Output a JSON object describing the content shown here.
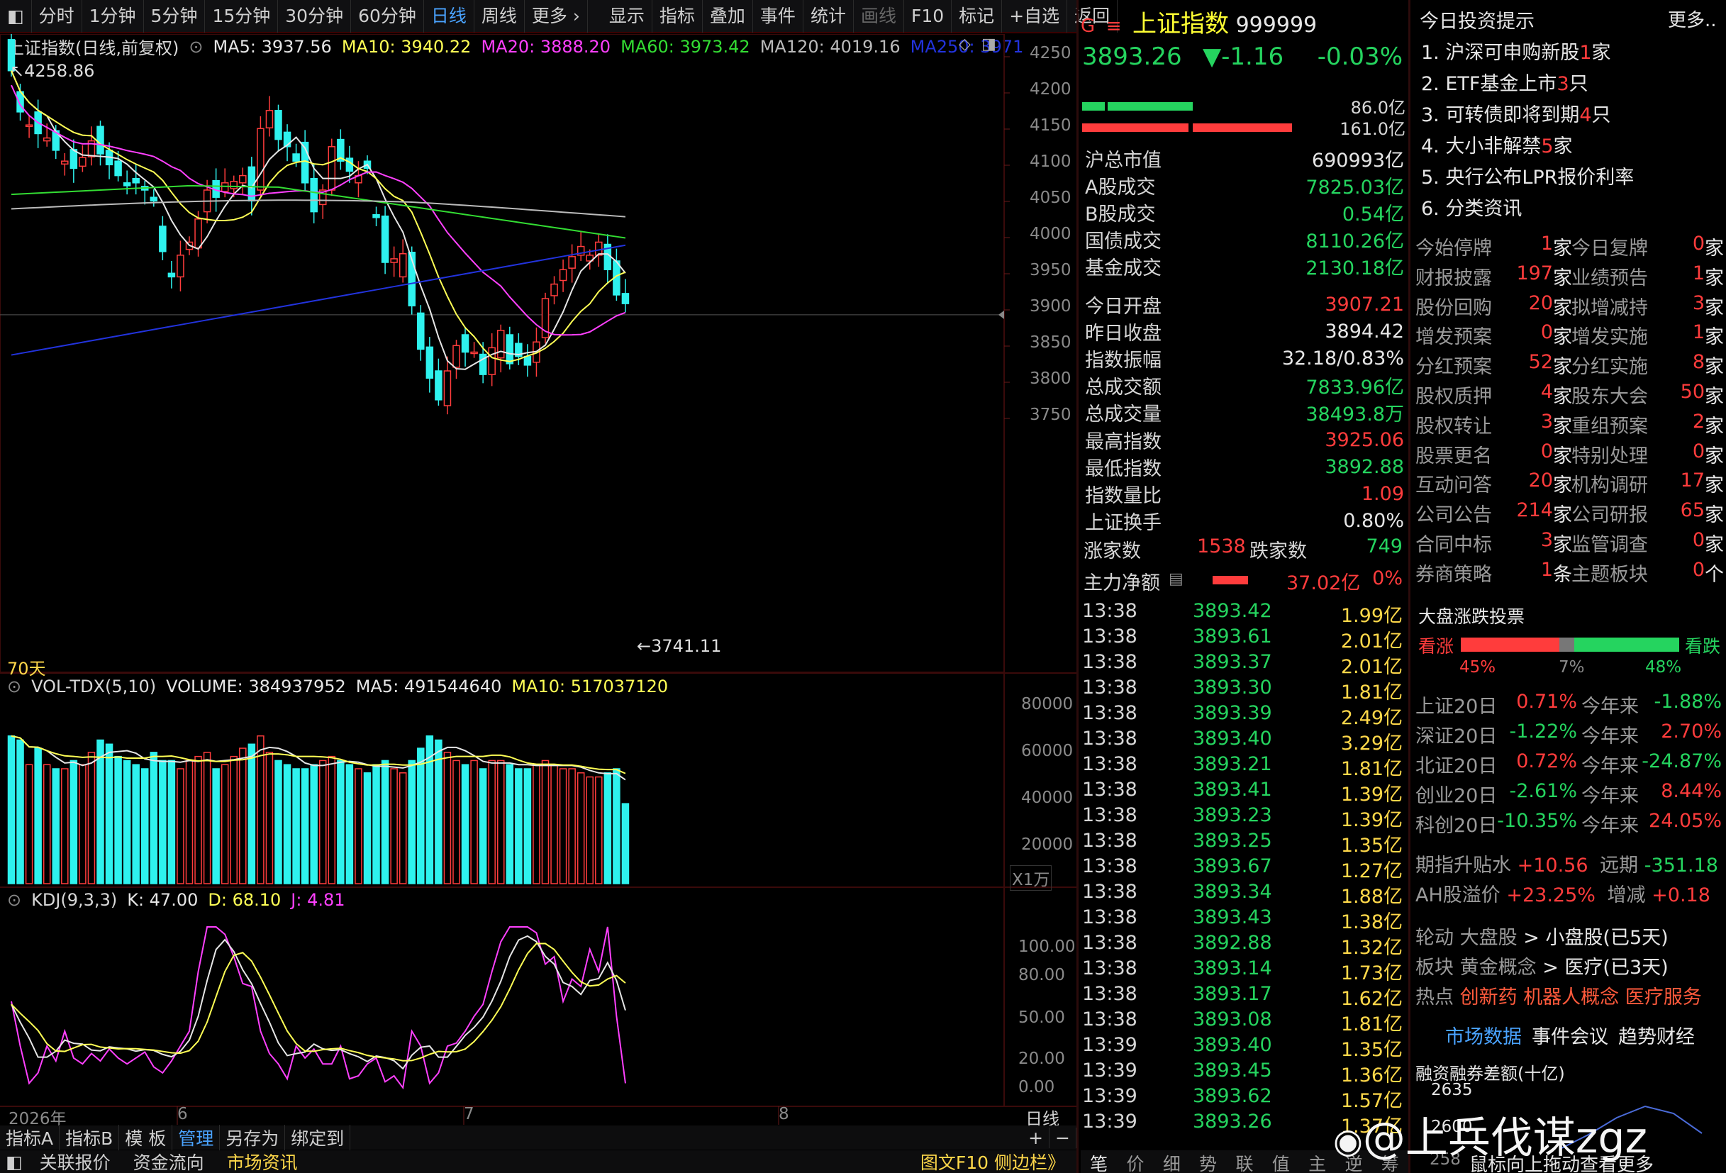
{
  "toolbar": {
    "periods": [
      "分时",
      "1分钟",
      "5分钟",
      "15分钟",
      "30分钟",
      "60分钟",
      "日线",
      "周线",
      "更多 ›"
    ],
    "active": "日线",
    "tools": [
      "显示",
      "指标",
      "叠加",
      "事件",
      "统计",
      "画线",
      "F10",
      "标记",
      "+自选",
      "返回"
    ]
  },
  "main_legend": {
    "title": "上证指数(日线,前复权)",
    "ma5": "MA5: 3937.56",
    "ma10": "MA10: 3940.22",
    "ma20": "MA20: 3888.20",
    "ma60": "MA60: 3973.42",
    "ma120": "MA120: 4019.16",
    "ma250": "MA250: 3971"
  },
  "colors": {
    "up": "#ff3c3c",
    "down": "#2ef2ee",
    "ma5": "#e6e6e6",
    "ma10": "#ffff55",
    "ma20": "#ff40ff",
    "ma60": "#33dd33",
    "ma120": "#bbbbbb",
    "ma250": "#2233dd",
    "accent": "#4aa3ff"
  },
  "main_axis": [
    "4250",
    "4200",
    "4150",
    "4100",
    "4050",
    "4000",
    "3950",
    "3900",
    "3850",
    "3800",
    "3750"
  ],
  "high_label": "4258.86",
  "low_label": "3741.11",
  "days_label": "70天",
  "vol_legend": {
    "title": "VOL-TDX(5,10)",
    "volume": "VOLUME: 384937952",
    "ma5": "MA5: 491544640",
    "ma10": "MA10: 517037120"
  },
  "vol_axis": [
    "80000",
    "60000",
    "40000",
    "20000"
  ],
  "vol_unit": "X1万",
  "kdj_legend": {
    "title": "KDJ(9,3,3)",
    "k": "K: 47.00",
    "d": "D: 68.10",
    "j": "J: 4.81"
  },
  "kdj_axis": [
    "100.00",
    "80.00",
    "50.00",
    "20.00",
    "0.00"
  ],
  "date_axis": {
    "year": "2026年",
    "m6": "6",
    "m7": "7",
    "m8": "8",
    "period": "日线"
  },
  "bottom_tabs": [
    "指标A",
    "指标B",
    "模 板",
    "管理",
    "另存为",
    "绑定到"
  ],
  "bottom_tabs2": [
    "关联报价",
    "资金流向",
    "市场资讯"
  ],
  "bottom_right": "图文F10 侧边栏》",
  "quote": {
    "name": "上证指数",
    "code": "999999",
    "price": "3893.26",
    "change": "▼-1.16",
    "pct": "-0.03%",
    "buy_amount": "86.0亿",
    "sell_amount": "161.0亿",
    "rows": [
      {
        "k": "沪总市值",
        "v": "690993亿",
        "c": "white"
      },
      {
        "k": "A股成交",
        "v": "7825.03亿",
        "c": "green"
      },
      {
        "k": "B股成交",
        "v": "0.54亿",
        "c": "green"
      },
      {
        "k": "国债成交",
        "v": "8110.26亿",
        "c": "green"
      },
      {
        "k": "基金成交",
        "v": "2130.18亿",
        "c": "green"
      },
      {
        "k": "今日开盘",
        "v": "3907.21",
        "c": "red"
      },
      {
        "k": "昨日收盘",
        "v": "3894.42",
        "c": "white"
      },
      {
        "k": "指数振幅",
        "v": "32.18/0.83%",
        "c": "white"
      },
      {
        "k": "总成交额",
        "v": "7833.96亿",
        "c": "green"
      },
      {
        "k": "总成交量",
        "v": "38493.8万",
        "c": "green"
      },
      {
        "k": "最高指数",
        "v": "3925.06",
        "c": "red"
      },
      {
        "k": "最低指数",
        "v": "3892.88",
        "c": "green"
      },
      {
        "k": "指数量比",
        "v": "1.09",
        "c": "red"
      },
      {
        "k": "上证换手",
        "v": "0.80%",
        "c": "white"
      }
    ],
    "up_label": "涨家数",
    "up_count": "1538",
    "down_label": "跌家数",
    "down_count": "749",
    "net_label": "主力净额",
    "net_value": "37.02亿",
    "net_pct": "0%"
  },
  "ticks": [
    [
      "13:38",
      "3893.42",
      "1.99亿"
    ],
    [
      "13:38",
      "3893.61",
      "2.01亿"
    ],
    [
      "13:38",
      "3893.37",
      "2.01亿"
    ],
    [
      "13:38",
      "3893.30",
      "1.81亿"
    ],
    [
      "13:38",
      "3893.39",
      "2.49亿"
    ],
    [
      "13:38",
      "3893.40",
      "3.29亿"
    ],
    [
      "13:38",
      "3893.21",
      "1.81亿"
    ],
    [
      "13:38",
      "3893.41",
      "1.39亿"
    ],
    [
      "13:38",
      "3893.23",
      "1.39亿"
    ],
    [
      "13:38",
      "3893.25",
      "1.35亿"
    ],
    [
      "13:38",
      "3893.67",
      "1.27亿"
    ],
    [
      "13:38",
      "3893.34",
      "1.88亿"
    ],
    [
      "13:38",
      "3893.43",
      "1.38亿"
    ],
    [
      "13:38",
      "3892.88",
      "1.32亿"
    ],
    [
      "13:38",
      "3893.14",
      "1.73亿"
    ],
    [
      "13:38",
      "3893.17",
      "1.62亿"
    ],
    [
      "13:38",
      "3893.08",
      "1.81亿"
    ],
    [
      "13:39",
      "3893.40",
      "1.35亿"
    ],
    [
      "13:39",
      "3893.45",
      "1.36亿"
    ],
    [
      "13:39",
      "3893.62",
      "1.57亿"
    ],
    [
      "13:39",
      "3893.26",
      "1.37亿"
    ]
  ],
  "tick_tabs": [
    "笔",
    "价",
    "细",
    "势",
    "联",
    "值",
    "主",
    "逆",
    "筹"
  ],
  "tips": {
    "title": "今日投资提示",
    "more": "更多..",
    "items": [
      {
        "pre": "1. 沪深可申购新股",
        "num": "1",
        "post": "家"
      },
      {
        "pre": "2. ETF基金上市",
        "num": "3",
        "post": "只"
      },
      {
        "pre": "3. 可转债即将到期",
        "num": "4",
        "post": "只"
      },
      {
        "pre": "4. 大小非解禁",
        "num": "5",
        "post": "家"
      },
      {
        "pre": "5. 央行公布LPR报价利率",
        "num": "",
        "post": ""
      },
      {
        "pre": "6. 分类资讯",
        "num": "",
        "post": ""
      }
    ]
  },
  "stats": [
    [
      "今始停牌",
      "1",
      "家",
      "今日复牌",
      "0",
      "家"
    ],
    [
      "财报披露",
      "197",
      "家",
      "业绩预告",
      "1",
      "家"
    ],
    [
      "股份回购",
      "20",
      "家",
      "拟增减持",
      "3",
      "家"
    ],
    [
      "增发预案",
      "0",
      "家",
      "增发实施",
      "1",
      "家"
    ],
    [
      "分红预案",
      "52",
      "家",
      "分红实施",
      "8",
      "家"
    ],
    [
      "股权质押",
      "4",
      "家",
      "股东大会",
      "50",
      "家"
    ],
    [
      "股权转让",
      "3",
      "家",
      "重组预案",
      "2",
      "家"
    ],
    [
      "股票更名",
      "0",
      "家",
      "特别处理",
      "0",
      "家"
    ],
    [
      "互动问答",
      "20",
      "家",
      "机构调研",
      "17",
      "家"
    ],
    [
      "公司公告",
      "214",
      "家",
      "公司研报",
      "65",
      "家"
    ],
    [
      "合同中标",
      "3",
      "家",
      "监管调查",
      "0",
      "家"
    ],
    [
      "券商策略",
      "1",
      "条",
      "主题板块",
      "0",
      "个"
    ]
  ],
  "vote": {
    "title": "大盘涨跌投票",
    "up_label": "看涨",
    "down_label": "看跌",
    "up_pct": "45%",
    "flat_pct": "7%",
    "down_pct": "48%",
    "up_frac": 0.45,
    "flat_frac": 0.07,
    "down_frac": 0.48
  },
  "indices": [
    [
      "上证20日",
      "0.71%",
      "red",
      "今年来",
      "-1.88%",
      "green"
    ],
    [
      "深证20日",
      "-1.22%",
      "green",
      "今年来",
      "2.70%",
      "red"
    ],
    [
      "北证20日",
      "0.72%",
      "red",
      "今年来",
      "-24.87%",
      "green"
    ],
    [
      "创业20日",
      "-2.61%",
      "green",
      "今年来",
      "8.44%",
      "red"
    ],
    [
      "科创20日",
      "-10.35%",
      "green",
      "今年来",
      "24.05%",
      "red"
    ]
  ],
  "futures": {
    "label1": "期指升贴水",
    "v1": "+10.56",
    "label2": "远期",
    "v2": "-351.18",
    "label3": "AH股溢价",
    "v3": "+23.25%",
    "label4": "增减",
    "v4": "+0.18"
  },
  "rotation": [
    {
      "k": "轮动",
      "a": "大盘股",
      "arrow": ">",
      "b": "小盘股(已5天)"
    },
    {
      "k": "板块",
      "a": "黄金概念",
      "arrow": ">",
      "b": "医疗(已3天)"
    }
  ],
  "hot": {
    "k": "热点",
    "items": [
      "创新药",
      "机器人概念",
      "医疗服务"
    ]
  },
  "links": [
    "市场数据",
    "事件会议",
    "趋势财经"
  ],
  "margin": {
    "title": "融资融券差额(十亿)",
    "v1": "2635",
    "v2": "2600",
    "v3": "258"
  },
  "margin_hint": "鼠标向上拖动查看更多",
  "watermark": "@上兵伐谋zgz"
}
